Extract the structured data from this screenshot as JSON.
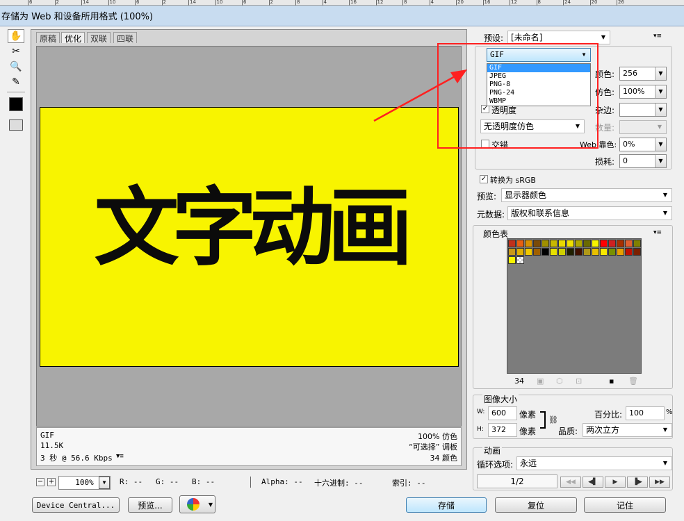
{
  "window": {
    "title": "存储为 Web 和设备所用格式 (100%)"
  },
  "ruler": {
    "ticks": [
      "6",
      "2",
      "14",
      "10",
      "6",
      "2",
      "14",
      "10",
      "6",
      "2",
      "8",
      "4",
      "16",
      "12",
      "8",
      "4",
      "20",
      "16",
      "12",
      "8",
      "24",
      "20",
      "26"
    ]
  },
  "tabs": [
    "原稿",
    "优化",
    "双联",
    "四联"
  ],
  "artwork": {
    "text": "文字动画"
  },
  "info": {
    "format": "GIF",
    "size": "11.5K",
    "time": "3 秒 @ 56.6 Kbps",
    "dither": "100% 仿色",
    "palette": "“可选择” 调板",
    "colors": "34 颜色"
  },
  "status": {
    "zoom": "100%",
    "r": "R: --",
    "g": "G: --",
    "b": "B: --",
    "alpha": "Alpha: --",
    "hex": "十六进制: --",
    "index": "索引: --"
  },
  "buttons": {
    "device_central": "Device Central...",
    "preview": "预览...",
    "save": "存储",
    "reset": "复位",
    "remember": "记住"
  },
  "settings": {
    "preset_label": "预设:",
    "preset_value": "[未命名]",
    "format_value": "GIF",
    "format_options": [
      "GIF",
      "JPEG",
      "PNG-8",
      "PNG-24",
      "WBMP"
    ],
    "colors_label": "颜色:",
    "colors_value": "256",
    "dither_label": "仿色:",
    "dither_value": "100%",
    "transparency_label": "透明度",
    "transparency_dither": "无透明度仿色",
    "matte_label": "杂边:",
    "amount_label": "数量:",
    "interlaced_label": "交错",
    "websnap_label": "Web 靠色:",
    "websnap_value": "0%",
    "lossy_label": "损耗:",
    "lossy_value": "0",
    "srgb_label": "转换为 sRGB",
    "preview_label": "预览:",
    "preview_value": "显示器颜色",
    "metadata_label": "元数据:",
    "metadata_value": "版权和联系信息"
  },
  "color_table": {
    "title": "颜色表",
    "count": "34",
    "swatches": [
      "#c0301a",
      "#e86010",
      "#d89000",
      "#7a4a08",
      "#a09000",
      "#c8b800",
      "#e8d800",
      "#f0e000",
      "#b0a800",
      "#6a6a00",
      "#f8f400",
      "#ff0000",
      "#d02020",
      "#a83000",
      "#e06030",
      "#808000",
      "#c89818",
      "#e0b000",
      "#f0c800",
      "#a06000",
      "#000000",
      "#e8e000",
      "#d0d000",
      "#202000",
      "#401000",
      "#b09818",
      "#e8c000",
      "#f8e800",
      "#789000",
      "#e8a000",
      "#c01000",
      "#7a2000",
      "#f8f400",
      "#ffffff"
    ]
  },
  "image_size": {
    "title": "图像大小",
    "w_label": "W:",
    "w_value": "600",
    "h_label": "H:",
    "h_value": "372",
    "unit": "像素",
    "percent_label": "百分比:",
    "percent_value": "100",
    "percent_unit": "%",
    "quality_label": "品质:",
    "quality_value": "两次立方"
  },
  "animation": {
    "title": "动画",
    "loop_label": "循环选项:",
    "loop_value": "永远",
    "frame": "1/2"
  }
}
